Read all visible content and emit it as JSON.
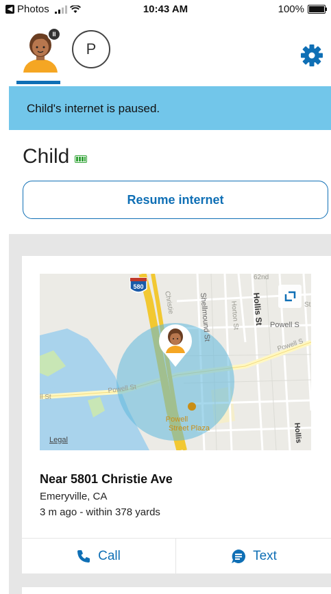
{
  "status_bar": {
    "back_app": "Photos",
    "time": "10:43 AM",
    "battery": "100%"
  },
  "profile": {
    "second_avatar_initial": "P",
    "pause_glyph": "II"
  },
  "banner": {
    "text": "Child's internet is paused."
  },
  "child": {
    "name": "Child",
    "resume_button": "Resume internet"
  },
  "location_card": {
    "map": {
      "labels": {
        "highway": "580",
        "christie": "Christie",
        "shellmound": "Shellmound St",
        "horton": "Horton St",
        "hollis": "Hollis St",
        "hollis_lower": "Hollis",
        "st62": "62nd",
        "powell_st": "Powell St",
        "powell_right": "Powell S",
        "st_left": "ll St",
        "st_right": "St",
        "plaza": "Powell\nStreet Plaza",
        "legal": "Legal"
      }
    },
    "address": "Near 5801 Christie Ave",
    "city": "Emeryville, CA",
    "time_accuracy": "3 m ago - within 378 yards",
    "call_label": "Call",
    "text_label": "Text"
  },
  "colors": {
    "accent": "#0f6fb5",
    "banner": "#72c6ea",
    "battery_green": "#31a336"
  }
}
